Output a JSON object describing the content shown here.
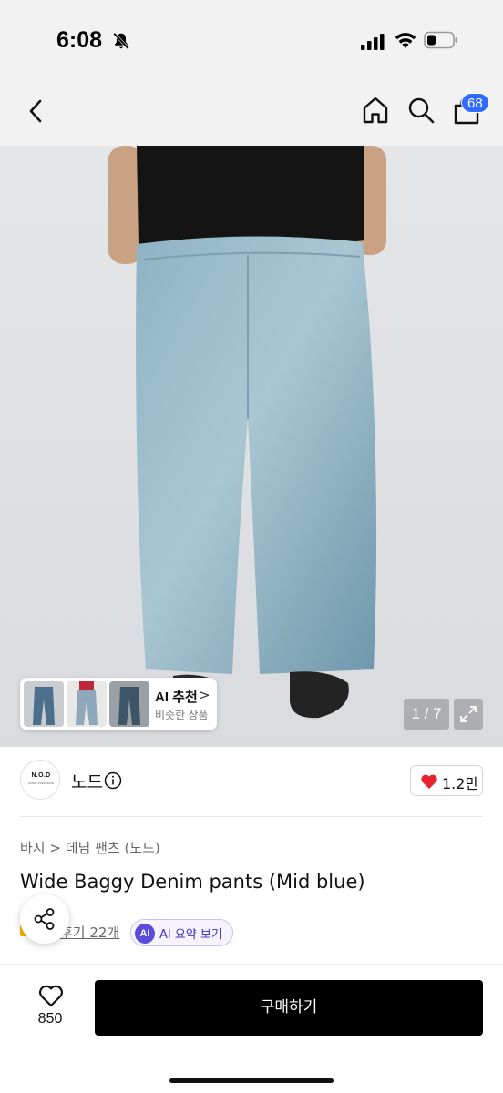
{
  "status_bar": {
    "time": "6:08",
    "icons": [
      "bell-slash-icon",
      "cellular-signal-icon",
      "wifi-icon",
      "battery-icon"
    ]
  },
  "nav": {
    "back_icon": "chevron-left-icon",
    "home_icon": "home-icon",
    "search_icon": "search-icon",
    "cart_icon": "shopping-bag-icon",
    "cart_badge": "68",
    "badge_color": "#2f6bff"
  },
  "gallery": {
    "ai_recommend_title": "AI 추천",
    "ai_recommend_chevron": ">",
    "ai_recommend_subtitle": "비슷한 상품",
    "page_indicator": "1 / 7",
    "expand_icon": "expand-icon"
  },
  "brand": {
    "logo_text": "N.O.D",
    "logo_subtext": "NOISE OVERDRIVE",
    "name": "노드",
    "info_icon": "info-icon",
    "like_count": "1.2만",
    "heart_color": "#e8232f"
  },
  "product": {
    "breadcrumb": "바지 > 데님 팬츠 (노드)",
    "title": "Wide Baggy Denim pants (Mid blue)",
    "review_link": "후기 22개",
    "ai_summary_icon_text": "AI",
    "ai_summary_label": "AI 요약 보기",
    "share_icon": "share-icon"
  },
  "bottom_bar": {
    "wish_icon": "heart-outline-icon",
    "wish_count": "850",
    "buy_label": "구매하기"
  }
}
